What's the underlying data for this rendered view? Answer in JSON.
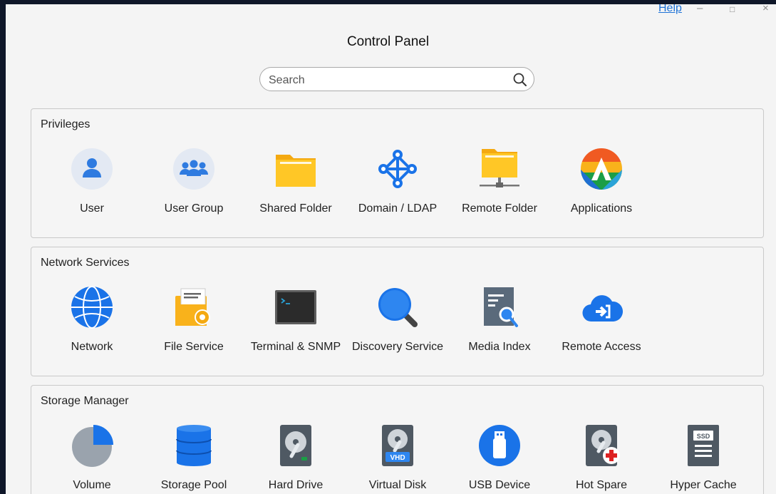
{
  "window": {
    "help_label": "Help",
    "minimize_glyph": "–",
    "maximize_glyph": "□",
    "close_glyph": "×"
  },
  "title": "Control Panel",
  "search": {
    "placeholder": "Search",
    "value": ""
  },
  "sections": [
    {
      "title": "Privileges",
      "items": [
        {
          "label": "User",
          "icon": "user-icon"
        },
        {
          "label": "User Group",
          "icon": "user-group-icon"
        },
        {
          "label": "Shared Folder",
          "icon": "shared-folder-icon"
        },
        {
          "label": "Domain / LDAP",
          "icon": "domain-ldap-icon"
        },
        {
          "label": "Remote Folder",
          "icon": "remote-folder-icon"
        },
        {
          "label": "Applications",
          "icon": "applications-icon"
        }
      ]
    },
    {
      "title": "Network Services",
      "items": [
        {
          "label": "Network",
          "icon": "network-globe-icon"
        },
        {
          "label": "File Service",
          "icon": "file-service-icon"
        },
        {
          "label": "Terminal & SNMP",
          "icon": "terminal-icon"
        },
        {
          "label": "Discovery Service",
          "icon": "discovery-magnifier-icon"
        },
        {
          "label": "Media Index",
          "icon": "media-index-icon"
        },
        {
          "label": "Remote Access",
          "icon": "remote-access-cloud-icon"
        }
      ]
    },
    {
      "title": "Storage Manager",
      "items": [
        {
          "label": "Volume",
          "icon": "volume-pie-icon"
        },
        {
          "label": "Storage Pool",
          "icon": "storage-pool-icon"
        },
        {
          "label": "Hard Drive",
          "icon": "hard-drive-icon"
        },
        {
          "label": "Virtual Disk",
          "icon": "virtual-disk-icon",
          "badge": "VHD"
        },
        {
          "label": "USB Device",
          "icon": "usb-device-icon"
        },
        {
          "label": "Hot Spare",
          "icon": "hot-spare-icon"
        },
        {
          "label": "Hyper Cache",
          "icon": "hyper-cache-icon",
          "badge": "SSD"
        }
      ]
    }
  ],
  "colors": {
    "accent_blue": "#1e72d6",
    "folder_yellow": "#ffc726",
    "bg": "#f4f4f4",
    "desktop": "#0f1729"
  }
}
